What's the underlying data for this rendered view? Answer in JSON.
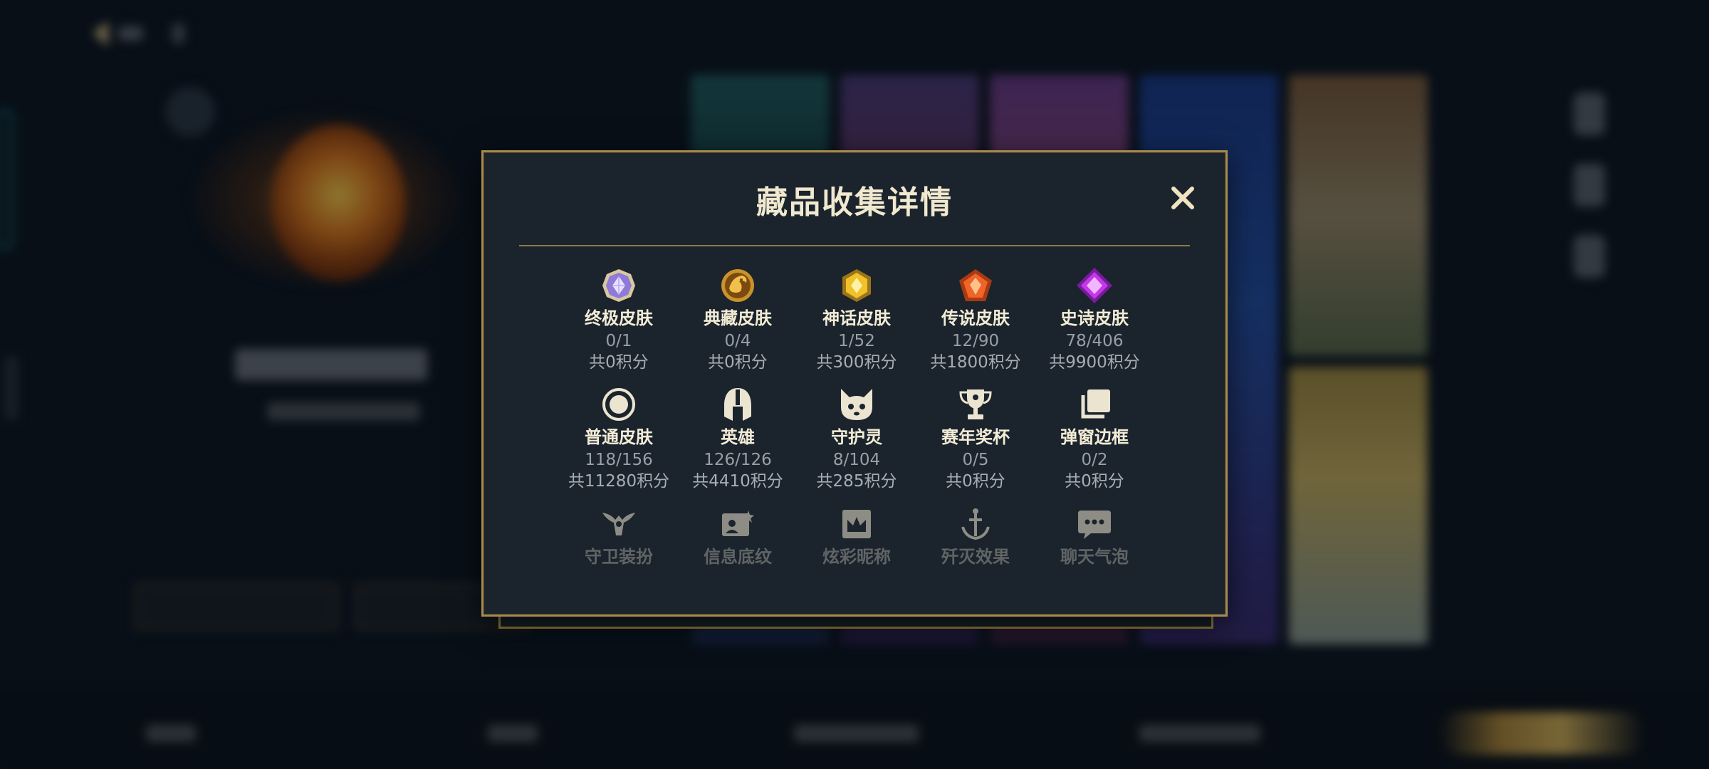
{
  "modal": {
    "title": "藏品收集详情",
    "close_label": "✕"
  },
  "categories": [
    {
      "label": "终极皮肤",
      "count": "0/1",
      "points": "共0积分",
      "icon": "ultimate-skin-icon"
    },
    {
      "label": "典藏皮肤",
      "count": "0/4",
      "points": "共0积分",
      "icon": "collector-skin-icon"
    },
    {
      "label": "神话皮肤",
      "count": "1/52",
      "points": "共300积分",
      "icon": "mythic-skin-icon"
    },
    {
      "label": "传说皮肤",
      "count": "12/90",
      "points": "共1800积分",
      "icon": "legendary-skin-icon"
    },
    {
      "label": "史诗皮肤",
      "count": "78/406",
      "points": "共9900积分",
      "icon": "epic-skin-icon"
    },
    {
      "label": "普通皮肤",
      "count": "118/156",
      "points": "共11280积分",
      "icon": "normal-skin-icon"
    },
    {
      "label": "英雄",
      "count": "126/126",
      "points": "共4410积分",
      "icon": "hero-helmet-icon"
    },
    {
      "label": "守护灵",
      "count": "8/104",
      "points": "共285积分",
      "icon": "guardian-spirit-icon"
    },
    {
      "label": "赛年奖杯",
      "count": "0/5",
      "points": "共0积分",
      "icon": "trophy-icon"
    },
    {
      "label": "弹窗边框",
      "count": "0/2",
      "points": "共0积分",
      "icon": "popup-frame-icon"
    },
    {
      "label": "守卫装扮",
      "icon": "ward-skin-icon"
    },
    {
      "label": "信息底纹",
      "icon": "info-card-icon"
    },
    {
      "label": "炫彩昵称",
      "icon": "colorful-name-icon"
    },
    {
      "label": "歼灭效果",
      "icon": "finisher-effect-icon"
    },
    {
      "label": "聊天气泡",
      "icon": "chat-bubble-icon"
    }
  ],
  "colors": {
    "accent_gold": "#a48a4e",
    "modal_bg": "#1b242d",
    "page_bg": "#0b1420"
  }
}
